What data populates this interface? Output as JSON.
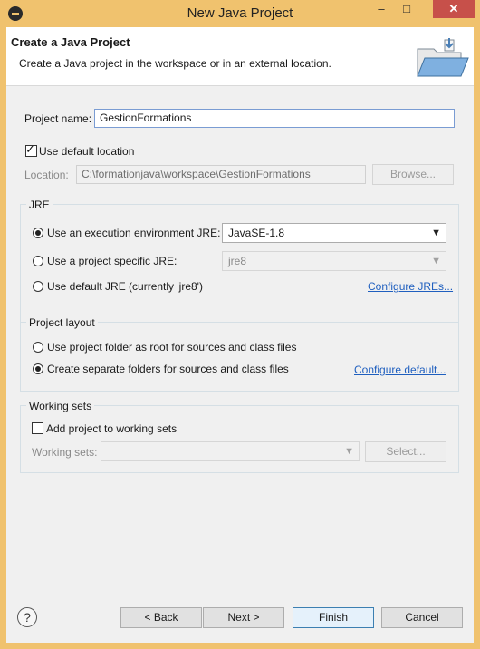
{
  "window": {
    "title": "New Java Project",
    "minimize": "–",
    "maximize": "□",
    "close": "✕"
  },
  "header": {
    "title": "Create a Java Project",
    "description": "Create a Java project in the workspace or in an external location."
  },
  "project": {
    "name_label": "Project name:",
    "name_value": "GestionFormations"
  },
  "location": {
    "use_default_label": "Use default location",
    "use_default_checked": true,
    "label": "Location:",
    "value": "C:\\formationjava\\workspace\\GestionFormations",
    "browse_label": "Browse..."
  },
  "jre": {
    "group_title": "JRE",
    "option_exec_env": "Use an execution environment JRE:",
    "exec_env_value": "JavaSE-1.8",
    "option_specific": "Use a project specific JRE:",
    "specific_value": "jre8",
    "option_default": "Use default JRE (currently 'jre8')",
    "configure_link": "Configure JREs...",
    "selected": "exec_env"
  },
  "layout": {
    "group_title": "Project layout",
    "option_root": "Use project folder as root for sources and class files",
    "option_separate": "Create separate folders for sources and class files",
    "configure_link": "Configure default...",
    "selected": "separate"
  },
  "working_sets": {
    "group_title": "Working sets",
    "add_label": "Add project to working sets",
    "add_checked": false,
    "sets_label": "Working sets:",
    "sets_value": "",
    "select_label": "Select..."
  },
  "footer": {
    "help": "?",
    "back": "< Back",
    "next": "Next >",
    "finish": "Finish",
    "cancel": "Cancel"
  }
}
